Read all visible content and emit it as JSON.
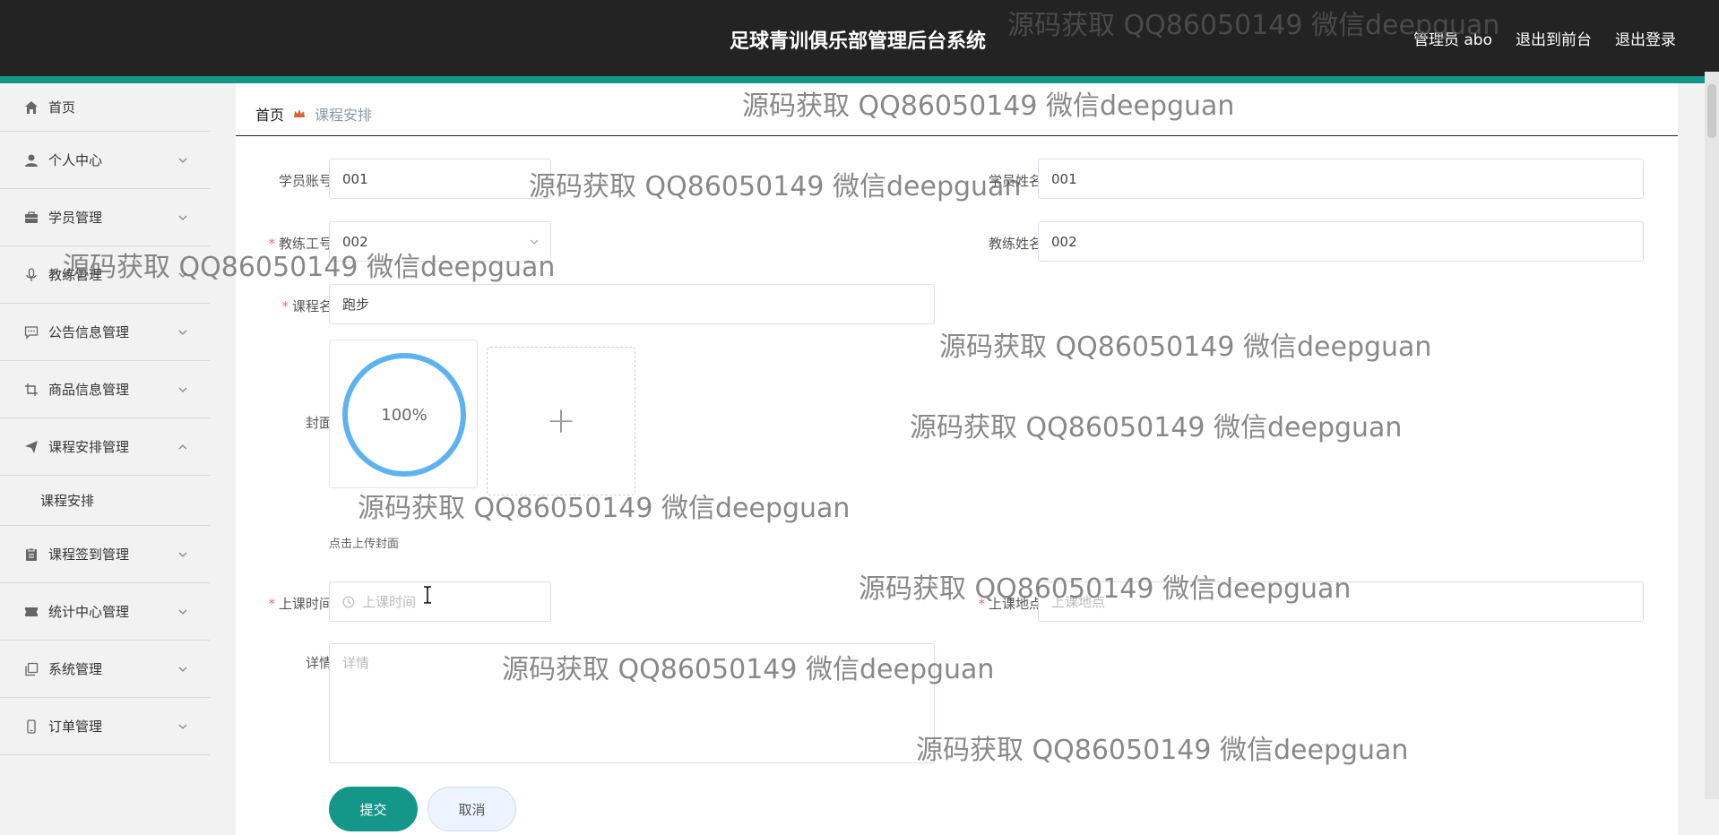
{
  "header": {
    "title": "足球青训俱乐部管理后台系统",
    "links": [
      "管理员 abo",
      "退出到前台",
      "退出登录"
    ]
  },
  "sidebar": {
    "items": [
      {
        "label": "首页",
        "icon": "home-icon"
      },
      {
        "label": "个人中心",
        "icon": "user-icon"
      },
      {
        "label": "学员管理",
        "icon": "briefcase-icon"
      },
      {
        "label": "教练管理",
        "icon": "microphone-icon"
      },
      {
        "label": "公告信息管理",
        "icon": "chat-icon"
      },
      {
        "label": "商品信息管理",
        "icon": "crop-icon"
      },
      {
        "label": "课程安排管理",
        "icon": "send-icon"
      },
      {
        "label": "课程签到管理",
        "icon": "clipboard-icon"
      },
      {
        "label": "统计中心管理",
        "icon": "ticket-icon"
      },
      {
        "label": "系统管理",
        "icon": "copy-icon"
      },
      {
        "label": "订单管理",
        "icon": "phone-icon"
      }
    ],
    "sub_item": "课程安排"
  },
  "breadcrumb": {
    "home": "首页",
    "current": "课程安排"
  },
  "form": {
    "student_account": {
      "label": "学员账号",
      "value": "001"
    },
    "student_name": {
      "label": "学员姓名",
      "value": "001"
    },
    "coach_id": {
      "label": "教练工号",
      "value": "002"
    },
    "coach_name": {
      "label": "教练姓名",
      "value": "002"
    },
    "course_name": {
      "label": "课程名",
      "value": "跑步"
    },
    "cover": {
      "label": "封面",
      "progress": 1.0,
      "progress_text": "100%",
      "hint": "点击上传封面"
    },
    "class_time": {
      "label": "上课时间",
      "placeholder": "上课时间"
    },
    "class_location": {
      "label": "上课地点",
      "placeholder": "上课地点"
    },
    "details": {
      "label": "详情",
      "placeholder": "详情"
    },
    "submit_label": "提交",
    "cancel_label": "取消"
  },
  "watermark_text": "源码获取 QQ86050149 微信deepguan",
  "colors": {
    "accent": "#149789",
    "header_bg": "#232323",
    "progress": "#5cb3f0"
  }
}
